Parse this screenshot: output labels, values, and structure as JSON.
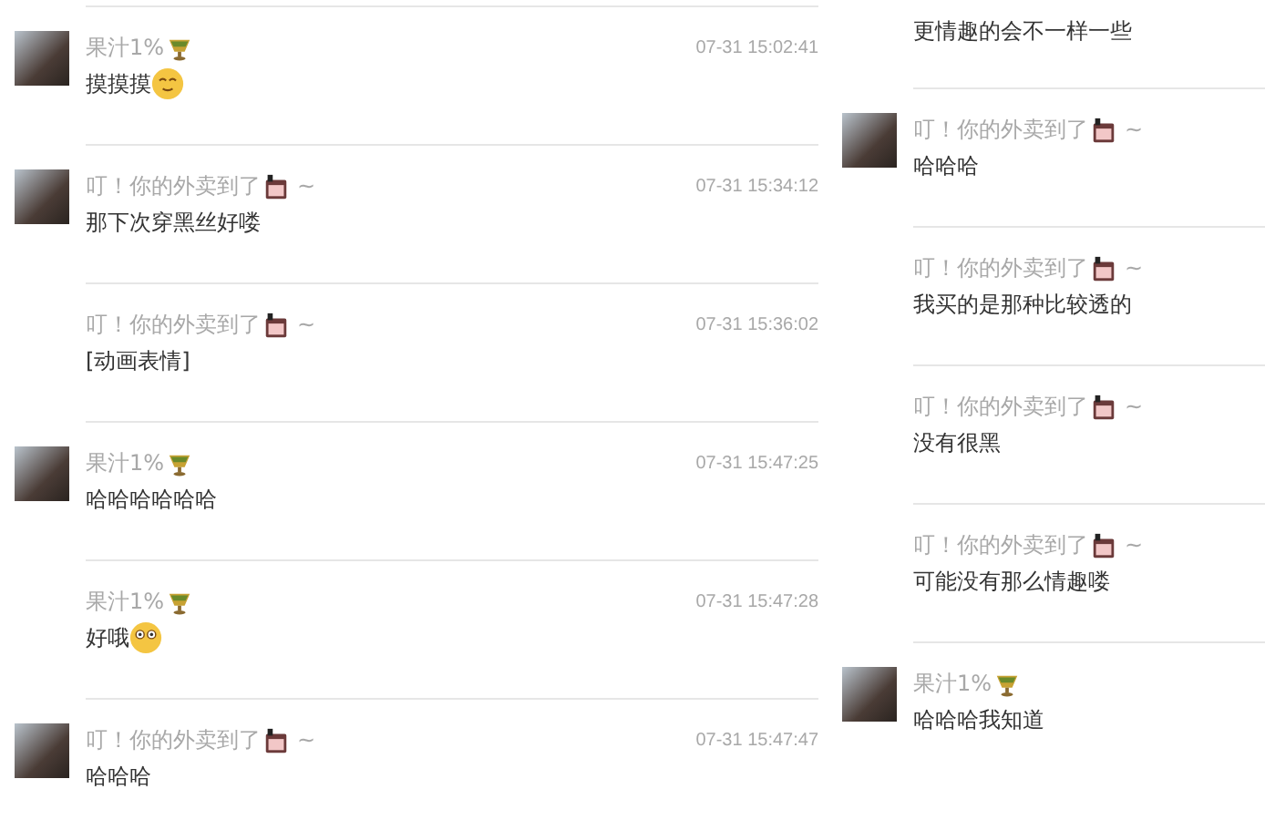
{
  "columns": [
    {
      "messages": [
        {
          "sender": "果汁1%",
          "badge": {
            "kind": "cup"
          },
          "avatar": true,
          "time": "07-31 15:02:41",
          "text": "摸摸摸",
          "emoji": {
            "kind": "smile"
          }
        },
        {
          "sender": "叮！你的外卖到了",
          "badge": {
            "kind": "box"
          },
          "suffix": "~",
          "avatar": true,
          "time": "07-31 15:34:12",
          "text": "那下次穿黑丝好喽"
        },
        {
          "sender": "叮！你的外卖到了",
          "badge": {
            "kind": "box"
          },
          "suffix": "~",
          "avatar": false,
          "time": "07-31 15:36:02",
          "text": "[动画表情]"
        },
        {
          "sender": "果汁1%",
          "badge": {
            "kind": "cup"
          },
          "avatar": true,
          "time": "07-31 15:47:25",
          "text": "哈哈哈哈哈哈"
        },
        {
          "sender": "果汁1%",
          "badge": {
            "kind": "cup"
          },
          "avatar": false,
          "time": "07-31 15:47:28",
          "text": "好哦",
          "emoji": {
            "kind": "wide-eyes"
          }
        },
        {
          "sender": "叮！你的外卖到了",
          "badge": {
            "kind": "box"
          },
          "suffix": "~",
          "avatar": true,
          "time": "07-31 15:47:47",
          "text": "哈哈哈"
        }
      ]
    },
    {
      "messages": [
        {
          "text": "更情趣的会不一样一些"
        },
        {
          "sender": "叮！你的外卖到了",
          "badge": {
            "kind": "box"
          },
          "suffix": "~",
          "avatar": true,
          "text": "哈哈哈"
        },
        {
          "sender": "叮！你的外卖到了",
          "badge": {
            "kind": "box"
          },
          "suffix": "~",
          "avatar": false,
          "text": "我买的是那种比较透的"
        },
        {
          "sender": "叮！你的外卖到了",
          "badge": {
            "kind": "box"
          },
          "suffix": "~",
          "avatar": false,
          "text": "没有很黑"
        },
        {
          "sender": "叮！你的外卖到了",
          "badge": {
            "kind": "box"
          },
          "suffix": "~",
          "avatar": false,
          "text": "可能没有那么情趣喽"
        },
        {
          "sender": "果汁1%",
          "badge": {
            "kind": "cup"
          },
          "avatar": true,
          "text": "哈哈哈我知道"
        }
      ]
    }
  ]
}
